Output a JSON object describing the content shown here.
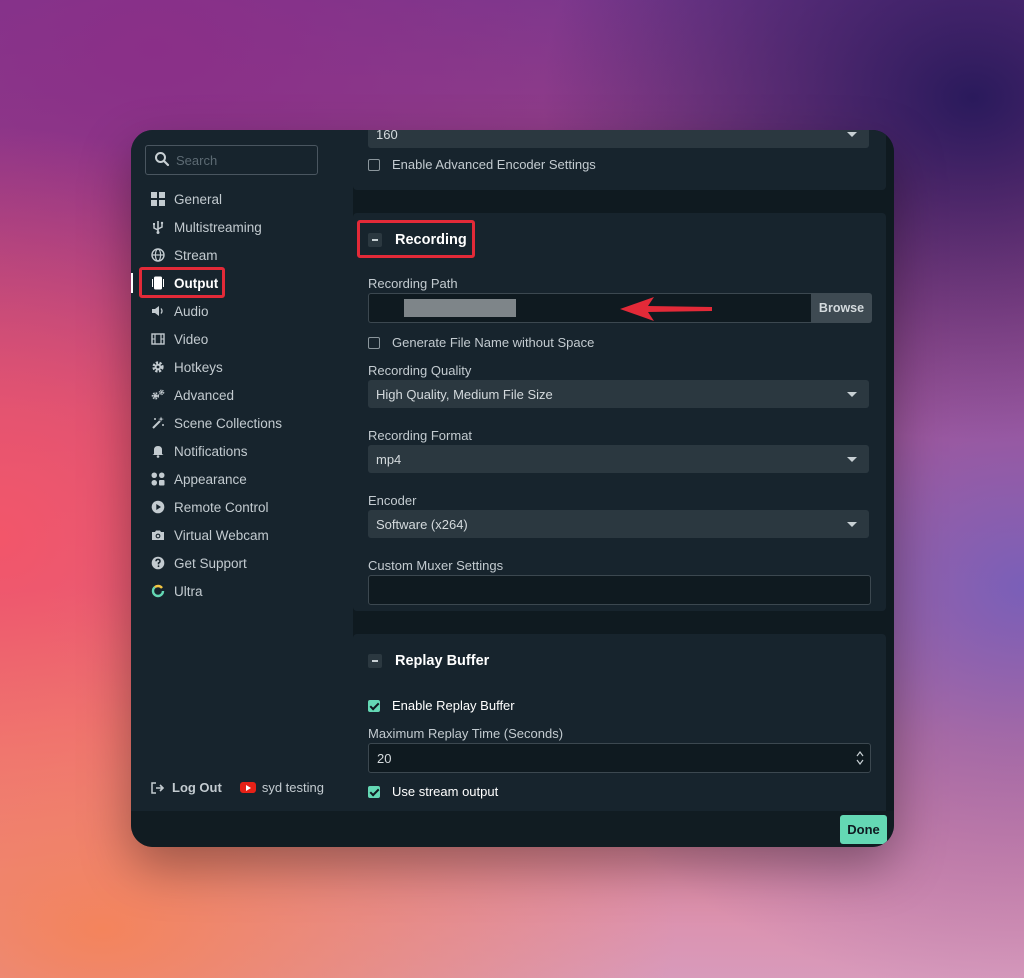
{
  "search": {
    "placeholder": "Search",
    "value": ""
  },
  "nav": {
    "items": [
      {
        "label": "General",
        "icon": "grid-icon"
      },
      {
        "label": "Multistreaming",
        "icon": "usb-fork-icon"
      },
      {
        "label": "Stream",
        "icon": "globe-icon"
      },
      {
        "label": "Output",
        "icon": "output-icon"
      },
      {
        "label": "Audio",
        "icon": "speaker-icon"
      },
      {
        "label": "Video",
        "icon": "film-icon"
      },
      {
        "label": "Hotkeys",
        "icon": "gear-icon"
      },
      {
        "label": "Advanced",
        "icon": "gears-icon"
      },
      {
        "label": "Scene Collections",
        "icon": "wand-icon"
      },
      {
        "label": "Notifications",
        "icon": "bell-icon"
      },
      {
        "label": "Appearance",
        "icon": "palette-icon"
      },
      {
        "label": "Remote Control",
        "icon": "play-circle-icon"
      },
      {
        "label": "Virtual Webcam",
        "icon": "camera-icon"
      },
      {
        "label": "Get Support",
        "icon": "help-circle-icon"
      },
      {
        "label": "Ultra",
        "icon": "ultra-ring-icon"
      }
    ],
    "active": "Output"
  },
  "footer": {
    "logout_label": "Log Out",
    "account_name": "syd testing"
  },
  "encoder_card": {
    "bitrate_value": "160",
    "advanced_encoder_label": "Enable Advanced Encoder Settings",
    "advanced_encoder_checked": false
  },
  "recording": {
    "title": "Recording",
    "path_label": "Recording Path",
    "browse_label": "Browse",
    "no_space_label": "Generate File Name without Space",
    "no_space_checked": false,
    "quality_label": "Recording Quality",
    "quality_value": "High Quality, Medium File Size",
    "format_label": "Recording Format",
    "format_value": "mp4",
    "encoder_label": "Encoder",
    "encoder_value": "Software (x264)",
    "muxer_label": "Custom Muxer Settings",
    "muxer_value": ""
  },
  "replay": {
    "title": "Replay Buffer",
    "enable_label": "Enable Replay Buffer",
    "enable_checked": true,
    "max_time_label": "Maximum Replay Time (Seconds)",
    "max_time_value": "20",
    "use_stream_label": "Use stream output",
    "use_stream_checked": true
  },
  "done_label": "Done",
  "colors": {
    "accent": "#64d8b4",
    "highlight": "#e32a38",
    "panel": "#17242d",
    "content_bg": "#0f1a20"
  }
}
